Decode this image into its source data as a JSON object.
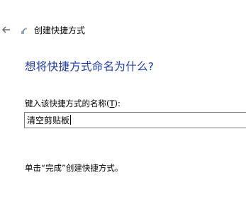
{
  "header": {
    "back_icon": "back-arrow-icon",
    "wizard_icon": "shortcut-wizard-icon",
    "title": "创建快捷方式"
  },
  "main": {
    "heading": "想将快捷方式命名为什么?",
    "field_label_prefix": "键入该快捷方式的名称(",
    "field_label_mnemonic": "T",
    "field_label_suffix": "):",
    "name_value": "清空剪贴板",
    "finish_hint": "单击“完成”创建快捷方式。"
  },
  "colors": {
    "heading": "#1f3ea8",
    "input_border": "#7a7a7a"
  }
}
